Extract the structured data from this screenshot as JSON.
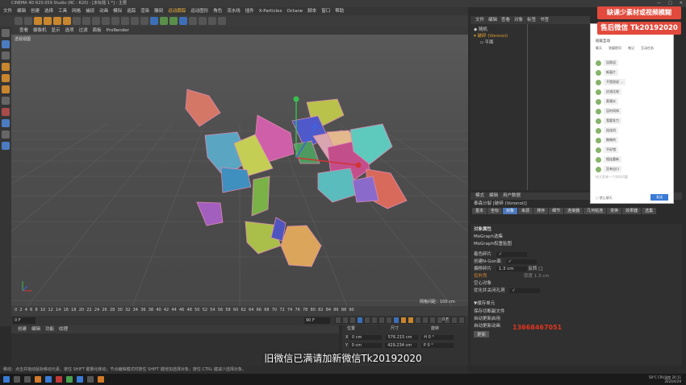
{
  "window_title": "CINEMA 4D R20.059 Studio (RC - R20) - [未标题 1 *] - 主要",
  "menu": [
    "文件",
    "编辑",
    "创建",
    "选择",
    "工具",
    "网格",
    "捕捉",
    "动画",
    "模拟",
    "追踪",
    "渲染",
    "雕刻",
    "运动跟踪",
    "运动图形",
    "角色",
    "流水线",
    "插件",
    "X-Particles",
    "Octane",
    "脚本",
    "窗口",
    "帮助"
  ],
  "menu_highlight_index": 12,
  "view_menu": [
    "查看",
    "摄像机",
    "显示",
    "选项",
    "过滤",
    "面板",
    "ProRender"
  ],
  "viewport_label": "透视视图",
  "grid_info": "网格间距：100 cm",
  "timeline_frames": [
    "0",
    "2",
    "4",
    "6",
    "8",
    "10",
    "12",
    "14",
    "16",
    "18",
    "20",
    "22",
    "24",
    "26",
    "28",
    "30",
    "32",
    "34",
    "36",
    "38",
    "40",
    "42",
    "44",
    "46",
    "48",
    "50",
    "52",
    "54",
    "56",
    "58",
    "60",
    "62",
    "64",
    "66",
    "68",
    "70",
    "72",
    "74",
    "76",
    "78",
    "80",
    "82",
    "84",
    "86",
    "88",
    "90"
  ],
  "current_frame": "0 F",
  "end_frame": "90 F",
  "right_frame": "0 F",
  "material_menu": [
    "创建",
    "编辑",
    "功能",
    "纹理"
  ],
  "coord_headers": {
    "pos": "位置",
    "size": "尺寸",
    "rot": "旋转"
  },
  "coord_rows": [
    {
      "axis": "X",
      "pos": "0 cm",
      "size": "576.215 cm",
      "rot": "H  0 °"
    },
    {
      "axis": "Y",
      "pos": "0 cm",
      "size": "429.234 cm",
      "rot": "P  0 °"
    }
  ],
  "object_menu": [
    "文件",
    "编辑",
    "查看",
    "对象",
    "标签",
    "书签"
  ],
  "objects": [
    "随机",
    "破碎 (Voronoi)",
    "平面"
  ],
  "attr_menu": [
    "模式",
    "编辑",
    "用户数据"
  ],
  "attr_title": "泰森分裂 [破碎 (Voronoi)]",
  "attr_tabs": [
    "基本",
    "坐标",
    "对象",
    "来源",
    "排序",
    "细节",
    "连接器",
    "几何粘连",
    "变换",
    "效果器",
    "选集"
  ],
  "attr_active_tab": 2,
  "attr_section": "对象属性",
  "attr_rows": [
    "MoGraph选集",
    "MoGraph权重贴图"
  ],
  "attr_checks": [
    {
      "label": "着色碎片",
      "value": "✓"
    },
    {
      "label": "创建N-Gon面",
      "value": "✓"
    },
    {
      "label": "偏移碎片",
      "value": "1.3 cm",
      "extra": "反转 □"
    },
    {
      "label": "仅外壳",
      "value": "",
      "extra": "厚度  1.3 cm",
      "orange": true
    },
    {
      "label": "空心对象",
      "value": ""
    },
    {
      "label": "优化并关闭孔洞",
      "value": "✓"
    }
  ],
  "attr_sub": "▼缓存单元",
  "attr_cache": [
    "保存切断副文件",
    "自动更新启用",
    "自动更新动画"
  ],
  "update_button": "更新",
  "chat": {
    "header": "班级互动",
    "tabs": [
      "聊天",
      "答疑提问",
      "笔记",
      "互动任务"
    ],
    "messages": [
      "没帮设",
      "新面片",
      "不是很说 ...",
      "应该比较",
      "蒸馏水",
      "没时间知",
      "我要发力",
      "连连机",
      "做做的",
      "不好错",
      "相连重新",
      "没有出口"
    ],
    "input_placeholder": "给大家来一个实时问题",
    "send": "发送",
    "bottom_label": "禁止聊天"
  },
  "banner_top": "缺课少素材或视频模糊",
  "banner_wechat": "售后微信 Tk20192020",
  "phone_overlay": "13668467051",
  "subtitle": "旧微信已满请加新微信Tk20192020",
  "status_text": "移动：点击并拖动鼠标移动元素。按住 SHIFT 键量化移动；节点编辑模式时按住 SHIFT 键增加选择对象；按住 CTRL 键减少选择对象。",
  "tray": {
    "temp": "58°C",
    "cpu": "CPU温度",
    "time": "20:11",
    "date": "2020/4/29"
  }
}
